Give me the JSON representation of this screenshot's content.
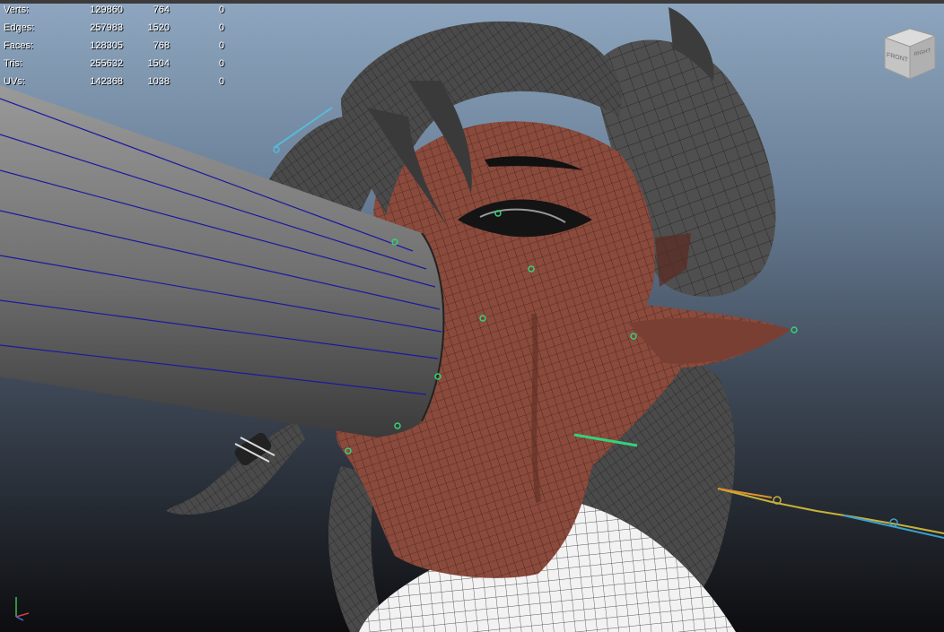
{
  "hud": {
    "rows": [
      {
        "label": "Verts:",
        "v1": "129860",
        "v2": "764",
        "v3": "0"
      },
      {
        "label": "Edges:",
        "v1": "257983",
        "v2": "1520",
        "v3": "0"
      },
      {
        "label": "Faces:",
        "v1": "128305",
        "v2": "768",
        "v3": "0"
      },
      {
        "label": "Tris:",
        "v1": "255632",
        "v2": "1504",
        "v3": "0"
      },
      {
        "label": "UVs:",
        "v1": "142368",
        "v2": "1038",
        "v3": "0"
      }
    ]
  },
  "viewcube": {
    "front_label": "FRONT",
    "right_label": "RIGHT"
  },
  "colors": {
    "skin": "#8a4a3c",
    "hair": "#4a4a4a",
    "wire": "#1c1c1c",
    "shirt": "#f2f2f2",
    "megaphone": "#7c7c7c",
    "joint_green": "#34d27a"
  }
}
